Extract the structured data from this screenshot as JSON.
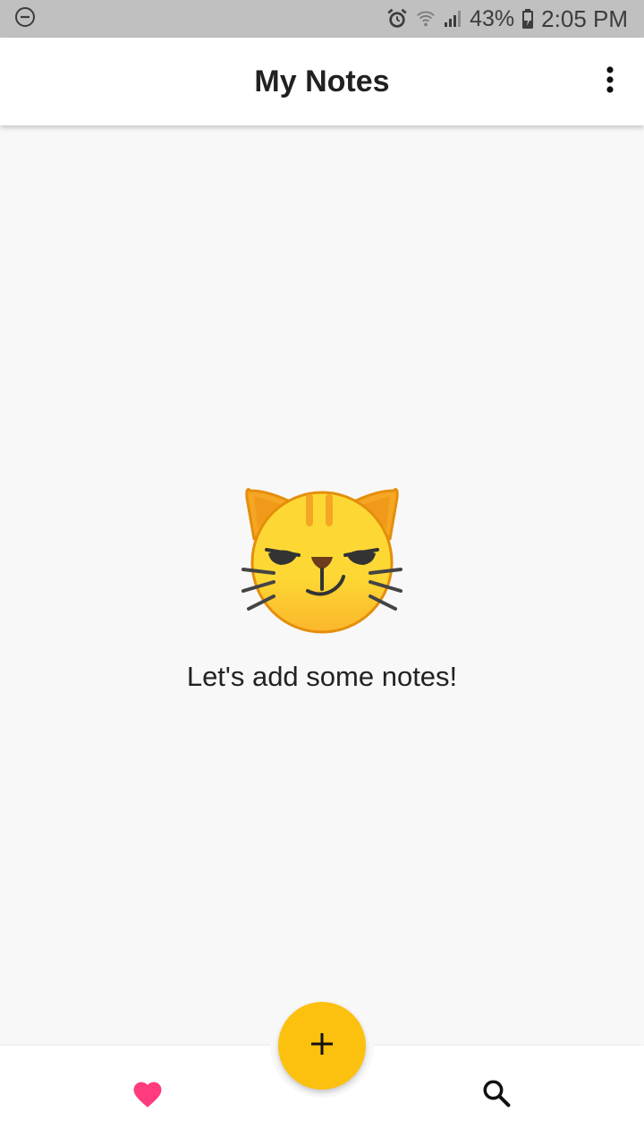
{
  "status_bar": {
    "battery_percent": "43%",
    "time": "2:05 PM",
    "icons": [
      "do-not-disturb-icon",
      "alarm-icon",
      "wifi-icon",
      "signal-icon",
      "battery-charging-icon"
    ]
  },
  "app_bar": {
    "title": "My Notes",
    "menu_icon": "more-vert-icon"
  },
  "empty_state": {
    "icon": "smirking-cat-emoji",
    "message": "Let's add some notes!"
  },
  "bottom_bar": {
    "left_icon": "heart-icon",
    "fab_icon": "plus-icon",
    "right_icon": "search-icon"
  },
  "colors": {
    "fab": "#fcc00f",
    "heart": "#ff3b7f",
    "status_bar": "#c0c0c0",
    "background": "#f8f8f8"
  }
}
